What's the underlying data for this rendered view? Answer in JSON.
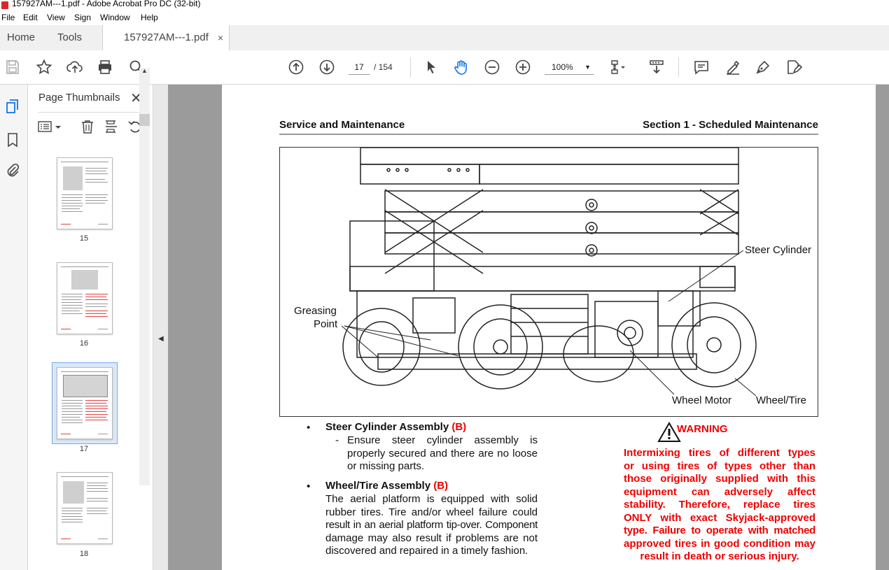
{
  "window": {
    "title": "157927AM---1.pdf - Adobe Acrobat Pro DC (32-bit)"
  },
  "menu": [
    "File",
    "Edit",
    "View",
    "Sign",
    "Window",
    "Help"
  ],
  "tabs": {
    "home": "Home",
    "tools": "Tools",
    "document": "157927AM---1.pdf",
    "close": "×"
  },
  "toolbar": {
    "page_current": "17",
    "page_total": "/ 154",
    "zoom": "100%"
  },
  "panel": {
    "title": "Page Thumbnails",
    "close": "✕",
    "thumbnails": [
      {
        "label": "15",
        "selected": false
      },
      {
        "label": "16",
        "selected": false
      },
      {
        "label": "17",
        "selected": true
      },
      {
        "label": "18",
        "selected": false
      }
    ]
  },
  "page": {
    "header_left": "Service and Maintenance",
    "header_right": "Section 1 - Scheduled Maintenance",
    "figure_callouts": {
      "steer_cylinder": "Steer Cylinder",
      "greasing": "Greasing",
      "point": "Point",
      "wheel_motor": "Wheel Motor",
      "wheel_tire": "Wheel/Tire"
    },
    "item1": {
      "bullet": "•",
      "title": "Steer Cylinder Assembly",
      "tag": "(B)",
      "dash": "-",
      "lines": [
        "Ensure steer cylinder assembly is",
        "properly secured and there are no loose",
        "or missing parts."
      ]
    },
    "item2": {
      "bullet": "•",
      "title": "Wheel/Tire Assembly",
      "tag": "(B)",
      "lines": [
        "The aerial platform is equipped with solid",
        "rubber tires. Tire and/or wheel failure could",
        "result in an aerial platform tip-over. Component",
        "damage may also result if problems are not",
        "discovered and repaired in a timely fashion."
      ]
    },
    "warning": {
      "title": "WARNING",
      "lines": [
        "Intermixing tires of different types",
        "or using tires of types other than",
        "those originally supplied with this",
        "equipment can adversely affect",
        "stability. Therefore, replace tires",
        "ONLY with exact Skyjack-approved",
        "type. Failure to operate with matched",
        "approved tires in good condition may",
        "result in death or serious injury."
      ]
    }
  },
  "colors": {
    "warning_red": "#ee0000",
    "selection_blue": "#7aa7e0"
  }
}
